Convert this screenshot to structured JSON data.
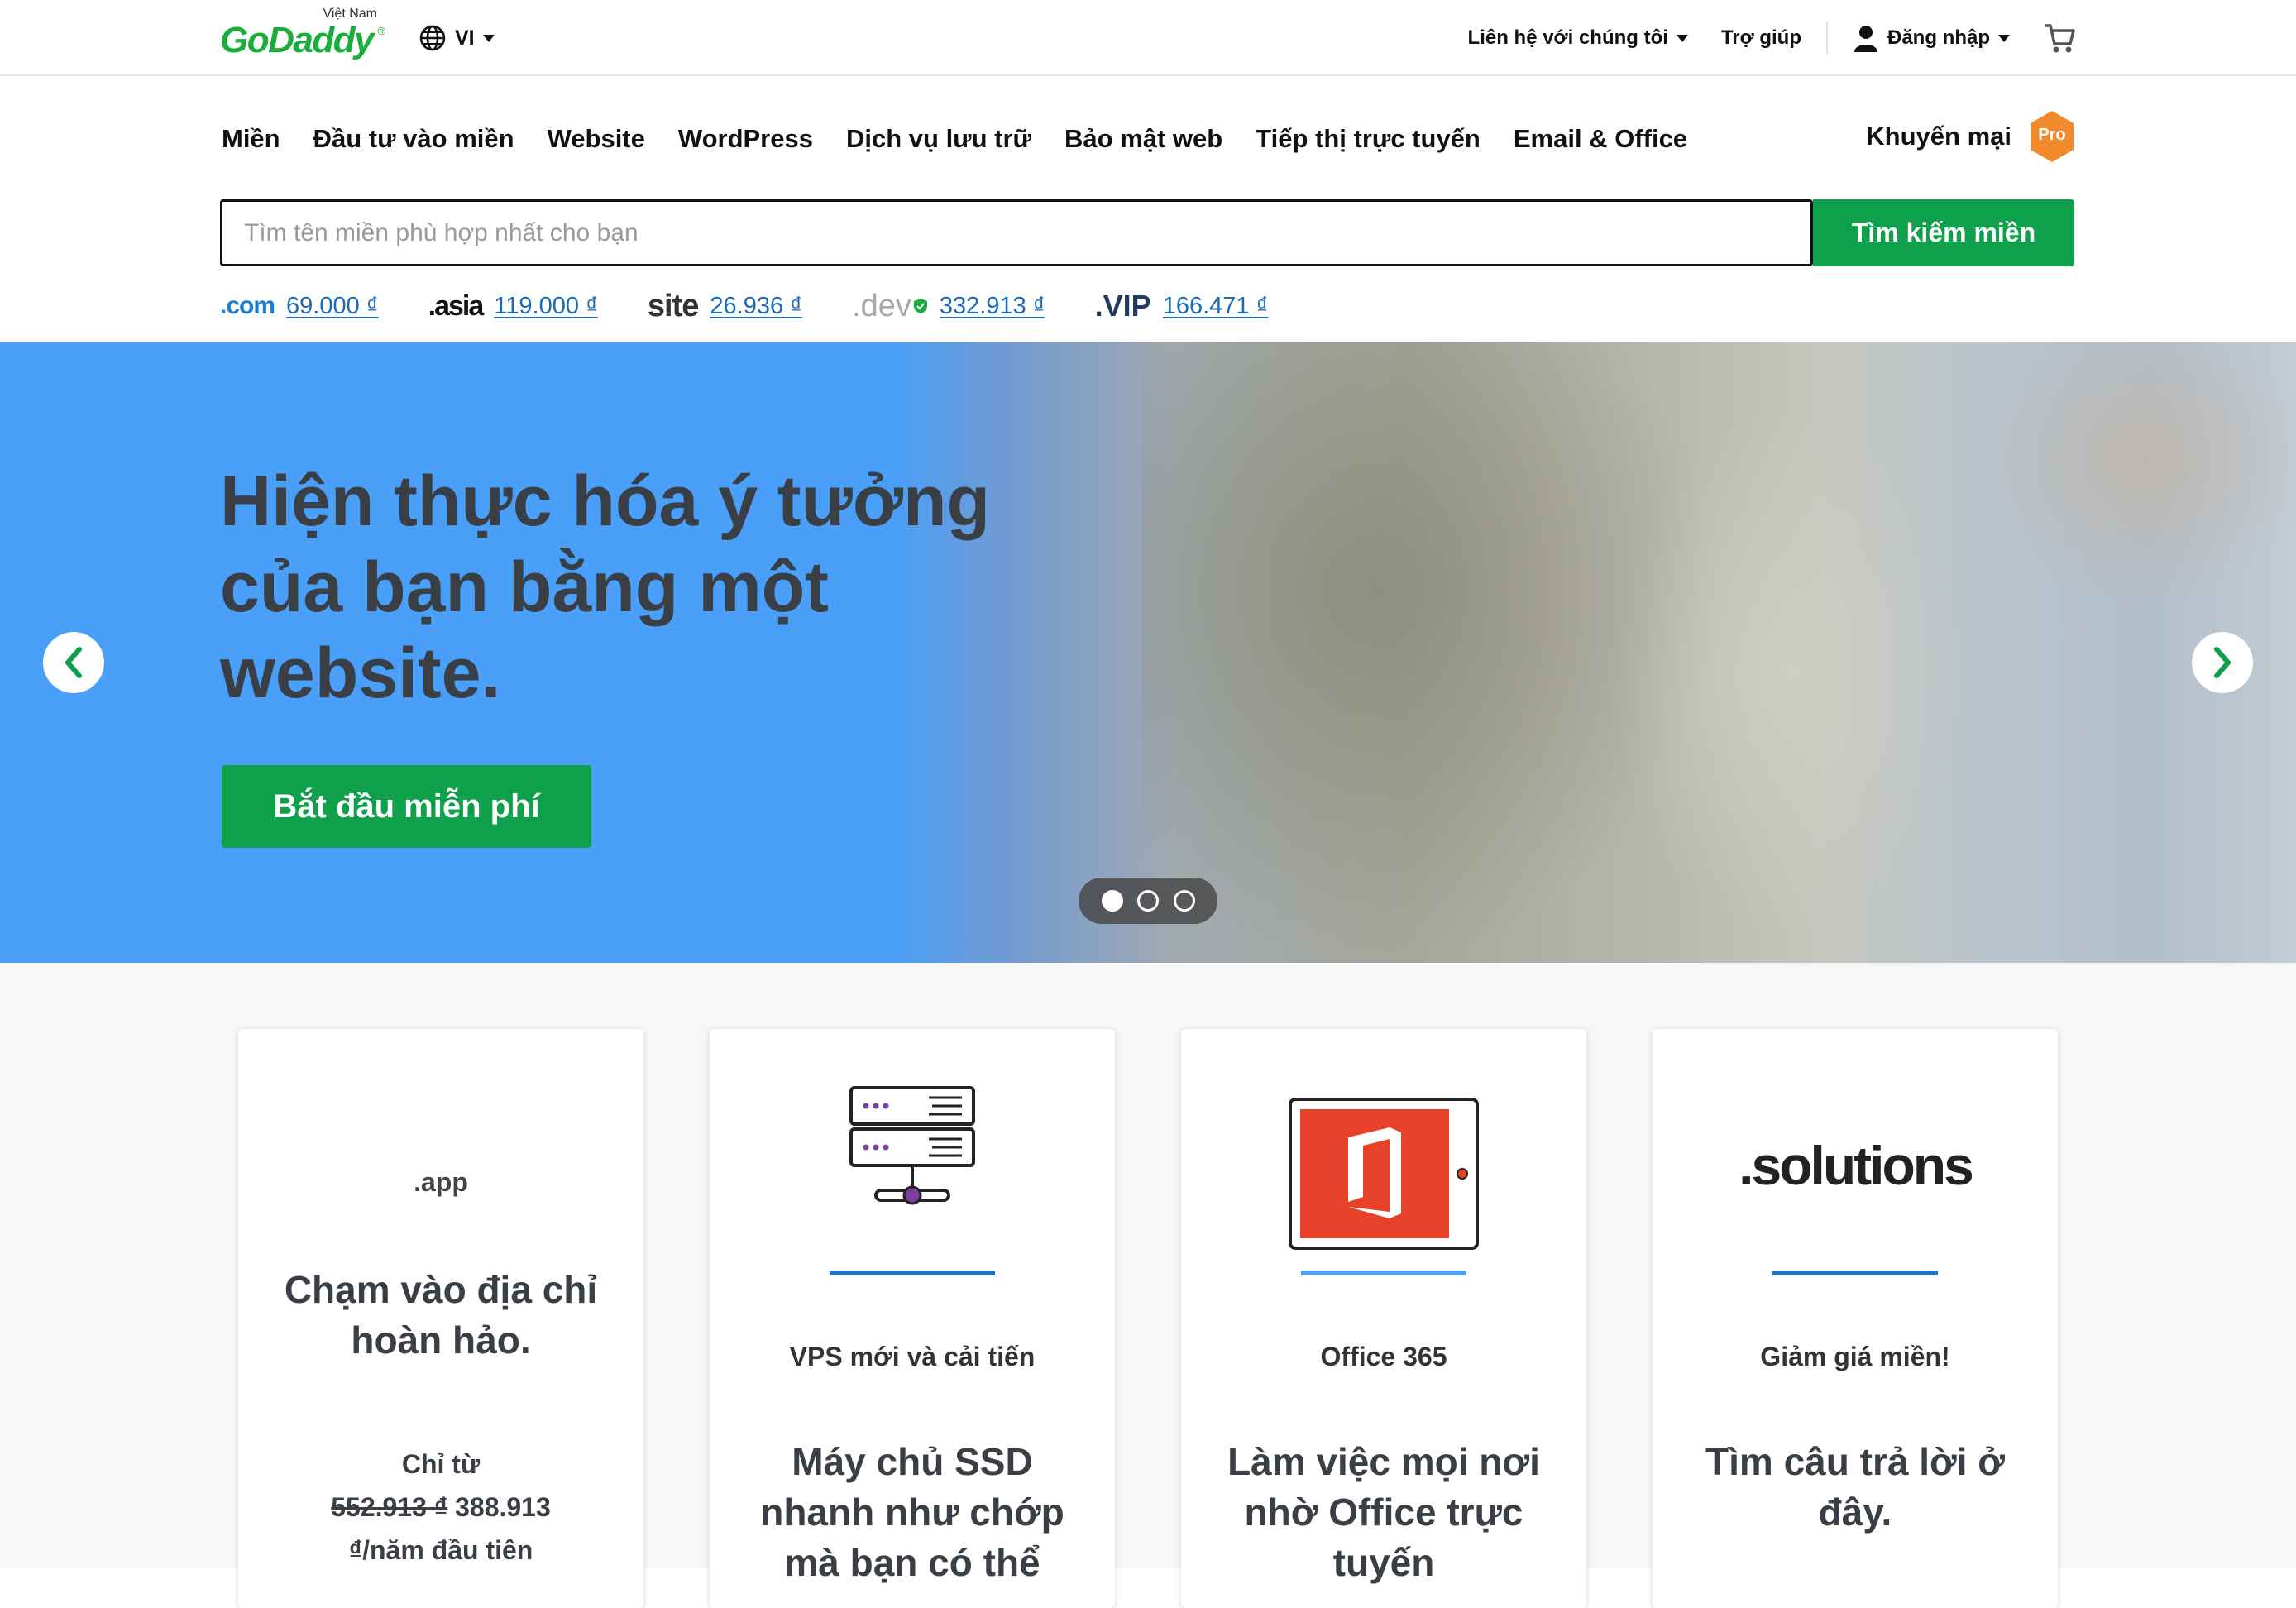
{
  "header": {
    "logo_text": "GoDaddy",
    "logo_country": "Việt Nam",
    "language": "VI",
    "contact_label": "Liên hệ với chúng tôi",
    "help_label": "Trợ giúp",
    "sign_in_label": "Đăng nhập"
  },
  "nav": {
    "items": [
      "Miền",
      "Đầu tư vào miền",
      "Website",
      "WordPress",
      "Dịch vụ lưu trữ",
      "Bảo mật web",
      "Tiếp thị trực tuyến",
      "Email & Office"
    ],
    "promo_label": "Khuyến mại",
    "pro_badge": "Pro"
  },
  "search": {
    "placeholder": "Tìm tên miền phù hợp nhất cho bạn",
    "value": "",
    "button_label": "Tìm kiếm miền"
  },
  "tlds": [
    {
      "name": ".com",
      "price": "69.000 ₫"
    },
    {
      "name": ".asia",
      "price": "119.000 ₫"
    },
    {
      "name": "site",
      "price": "26.936 ₫"
    },
    {
      "name": ".dev",
      "price": "332.913 ₫"
    },
    {
      "name": ".VIP",
      "price": "166.471 ₫"
    }
  ],
  "hero": {
    "title": "Hiện thực hóa ý tưởng của bạn bằng một website.",
    "cta_label": "Bắt đầu miễn phí",
    "slides_total": 3,
    "active_slide": 1
  },
  "cards": [
    {
      "media_text": ".app",
      "heading": "Chạm vào địa chỉ hoàn hảo.",
      "price_prefix": "Chỉ từ",
      "old_price": "552.913 ₫",
      "new_price": "388.913",
      "price_suffix": "₫/năm đầu tiên"
    },
    {
      "label": "VPS mới và cải tiến",
      "heading": "Máy chủ SSD nhanh như chớp mà bạn có thể"
    },
    {
      "label": "Office 365",
      "heading": "Làm việc mọi nơi nhờ Office trực tuyến"
    },
    {
      "media_text": ".solutions",
      "label": "Giảm giá miền!",
      "heading": "Tìm câu trả lời ở đây."
    }
  ],
  "colors": {
    "brand_green": "#1bad3b",
    "button_green": "#0ea04a",
    "link_blue": "#1a6bb8",
    "hero_blue": "#4a9ff8",
    "pro_orange": "#f08a2c"
  }
}
